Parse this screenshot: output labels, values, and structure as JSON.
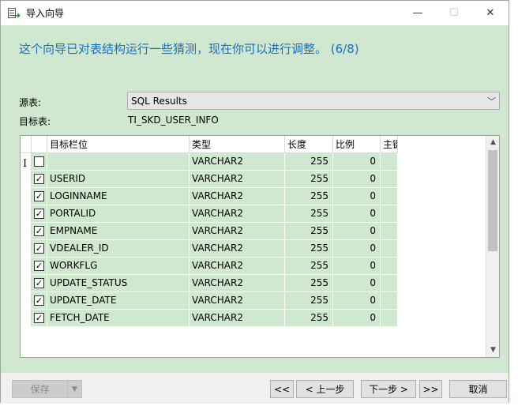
{
  "window": {
    "title": "导入向导",
    "minimize_glyph": "—",
    "maximize_glyph": "☐",
    "close_glyph": "✕"
  },
  "heading": "这个向导已对表结构运行一些猜测，现在你可以进行调整。 (6/8)",
  "source": {
    "label": "源表:",
    "value": "SQL Results"
  },
  "target": {
    "label": "目标表:",
    "value": "TI_SKD_USER_INFO"
  },
  "grid": {
    "columns": [
      "目标栏位",
      "类型",
      "长度",
      "比例",
      "主键"
    ],
    "rows": [
      {
        "checked": false,
        "name": "",
        "type": "VARCHAR2",
        "length": "255",
        "scale": "0"
      },
      {
        "checked": true,
        "name": "USERID",
        "type": "VARCHAR2",
        "length": "255",
        "scale": "0"
      },
      {
        "checked": true,
        "name": "LOGINNAME",
        "type": "VARCHAR2",
        "length": "255",
        "scale": "0"
      },
      {
        "checked": true,
        "name": "PORTALID",
        "type": "VARCHAR2",
        "length": "255",
        "scale": "0"
      },
      {
        "checked": true,
        "name": "EMPNAME",
        "type": "VARCHAR2",
        "length": "255",
        "scale": "0"
      },
      {
        "checked": true,
        "name": "VDEALER_ID",
        "type": "VARCHAR2",
        "length": "255",
        "scale": "0"
      },
      {
        "checked": true,
        "name": "WORKFLG",
        "type": "VARCHAR2",
        "length": "255",
        "scale": "0"
      },
      {
        "checked": true,
        "name": "UPDATE_STATUS",
        "type": "VARCHAR2",
        "length": "255",
        "scale": "0"
      },
      {
        "checked": true,
        "name": "UPDATE_DATE",
        "type": "VARCHAR2",
        "length": "255",
        "scale": "0"
      },
      {
        "checked": true,
        "name": "FETCH_DATE",
        "type": "VARCHAR2",
        "length": "255",
        "scale": "0"
      }
    ]
  },
  "buttons": {
    "save": "保存",
    "first": "<<",
    "prev": "< 上一步",
    "next": "下一步 >",
    "last": ">>",
    "cancel": "取消"
  },
  "colors": {
    "accent": "#1a6fc2",
    "panel": "#cfe8cf"
  }
}
